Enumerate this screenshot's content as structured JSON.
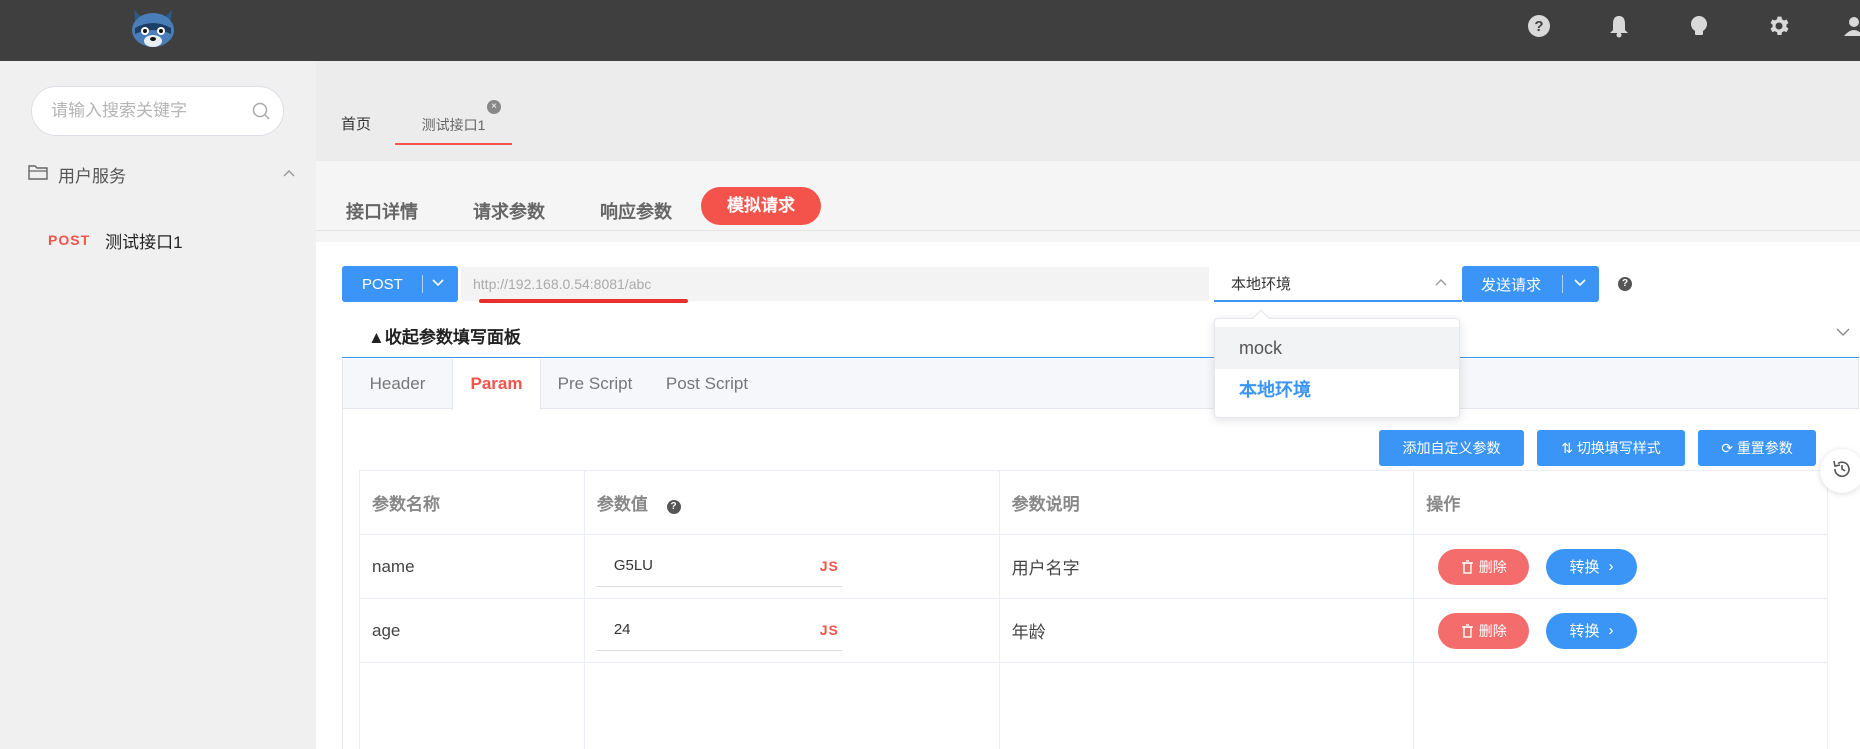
{
  "topbar": {
    "icons": [
      "help-icon",
      "bell-icon",
      "lightbulb-icon",
      "gear-icon",
      "user-icon"
    ]
  },
  "sidebar": {
    "search_placeholder": "请输入搜索关键字",
    "group_label": "用户服务",
    "api_item": {
      "method": "POST",
      "name": "测试接口1"
    }
  },
  "page_tabs": {
    "home": "首页",
    "active": "测试接口1"
  },
  "sub_tabs": [
    "接口详情",
    "请求参数",
    "响应参数",
    "模拟请求"
  ],
  "request": {
    "method": "POST",
    "url_placeholder": "http://192.168.0.54:8081/abc",
    "environment": "本地环境",
    "send_label": "发送请求"
  },
  "collapse_label": "▲收起参数填写面板",
  "param_tabs": [
    "Header",
    "Param",
    "Pre Script",
    "Post Script"
  ],
  "tools": [
    "添加自定义参数",
    "切换填写样式",
    "重置参数"
  ],
  "table": {
    "headers": [
      "参数名称",
      "参数值",
      "参数说明",
      "操作"
    ],
    "rows": [
      {
        "name": "name",
        "value": "G5LU",
        "desc": "用户名字"
      },
      {
        "name": "age",
        "value": "24",
        "desc": "年龄"
      }
    ],
    "js_tag": "JS",
    "delete_label": "删除",
    "convert_label": "转换"
  },
  "dropdown": {
    "options": [
      "mock",
      "本地环境"
    ],
    "selected": "本地环境"
  },
  "colors": {
    "accent_red": "#f4534c",
    "primary_blue": "#3a95f7",
    "topbar": "#3f3f3f"
  }
}
